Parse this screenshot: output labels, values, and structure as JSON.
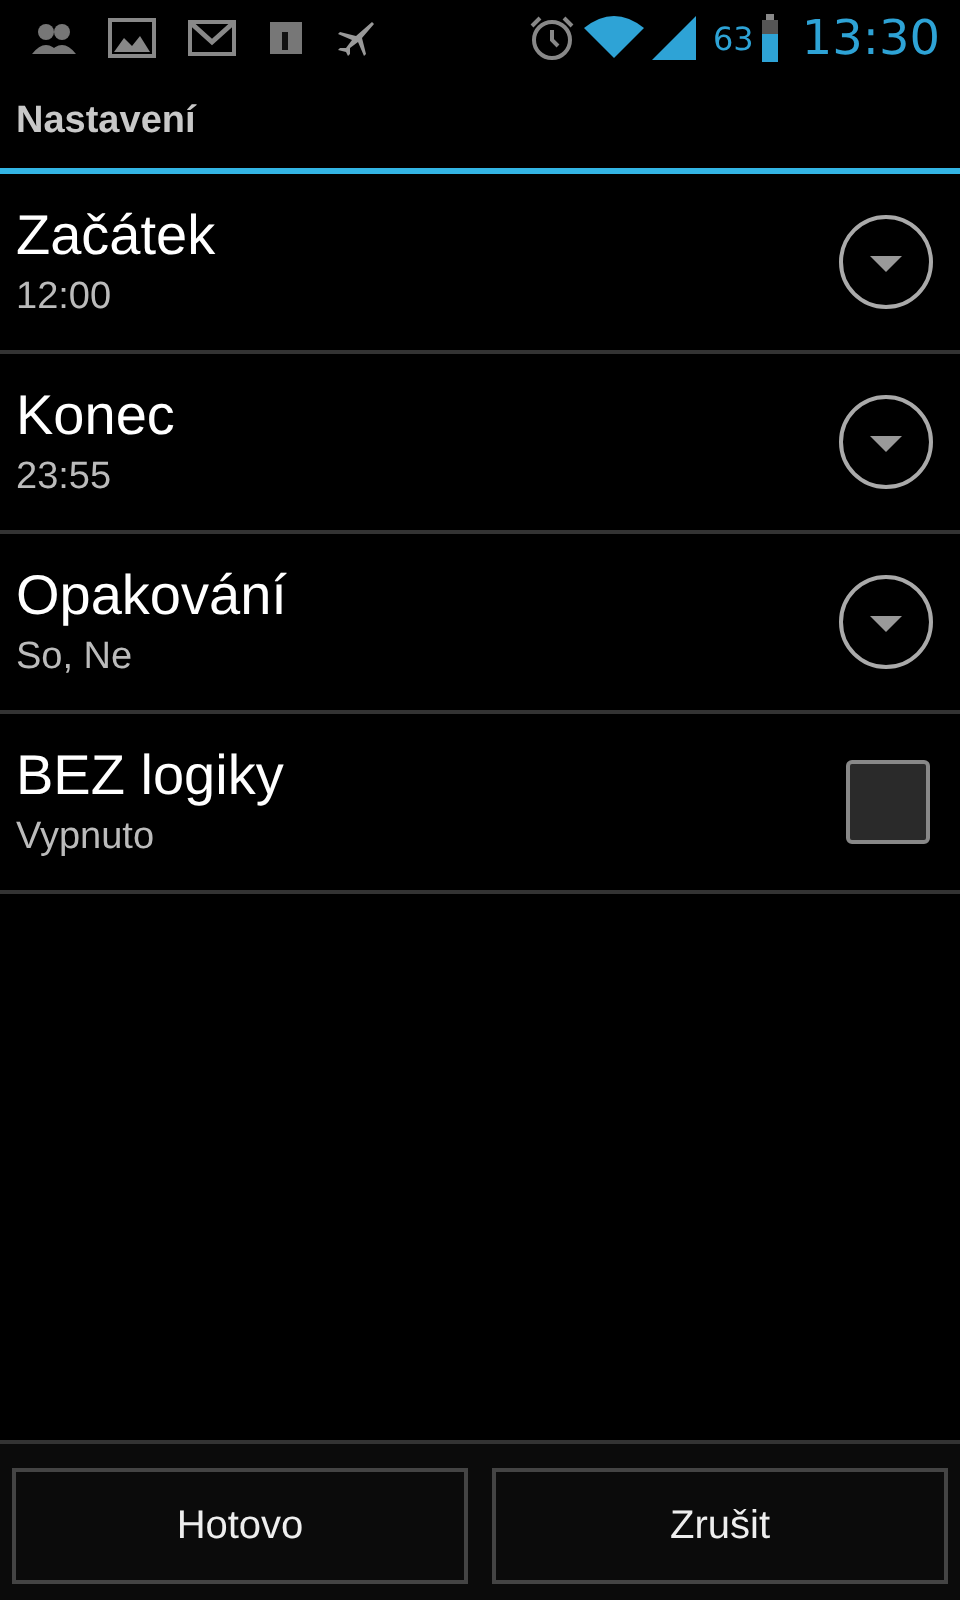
{
  "status_bar": {
    "battery_percent": "63",
    "time": "13:30"
  },
  "title": "Nastavení",
  "settings": [
    {
      "kind": "dropdown",
      "title": "Začátek",
      "summary": "12:00"
    },
    {
      "kind": "dropdown",
      "title": "Konec",
      "summary": "23:55"
    },
    {
      "kind": "dropdown",
      "title": "Opakování",
      "summary": "So, Ne"
    },
    {
      "kind": "checkbox",
      "title": "BEZ logiky",
      "summary": "Vypnuto",
      "checked": false
    }
  ],
  "buttons": [
    "Hotovo",
    "Zrušit"
  ]
}
